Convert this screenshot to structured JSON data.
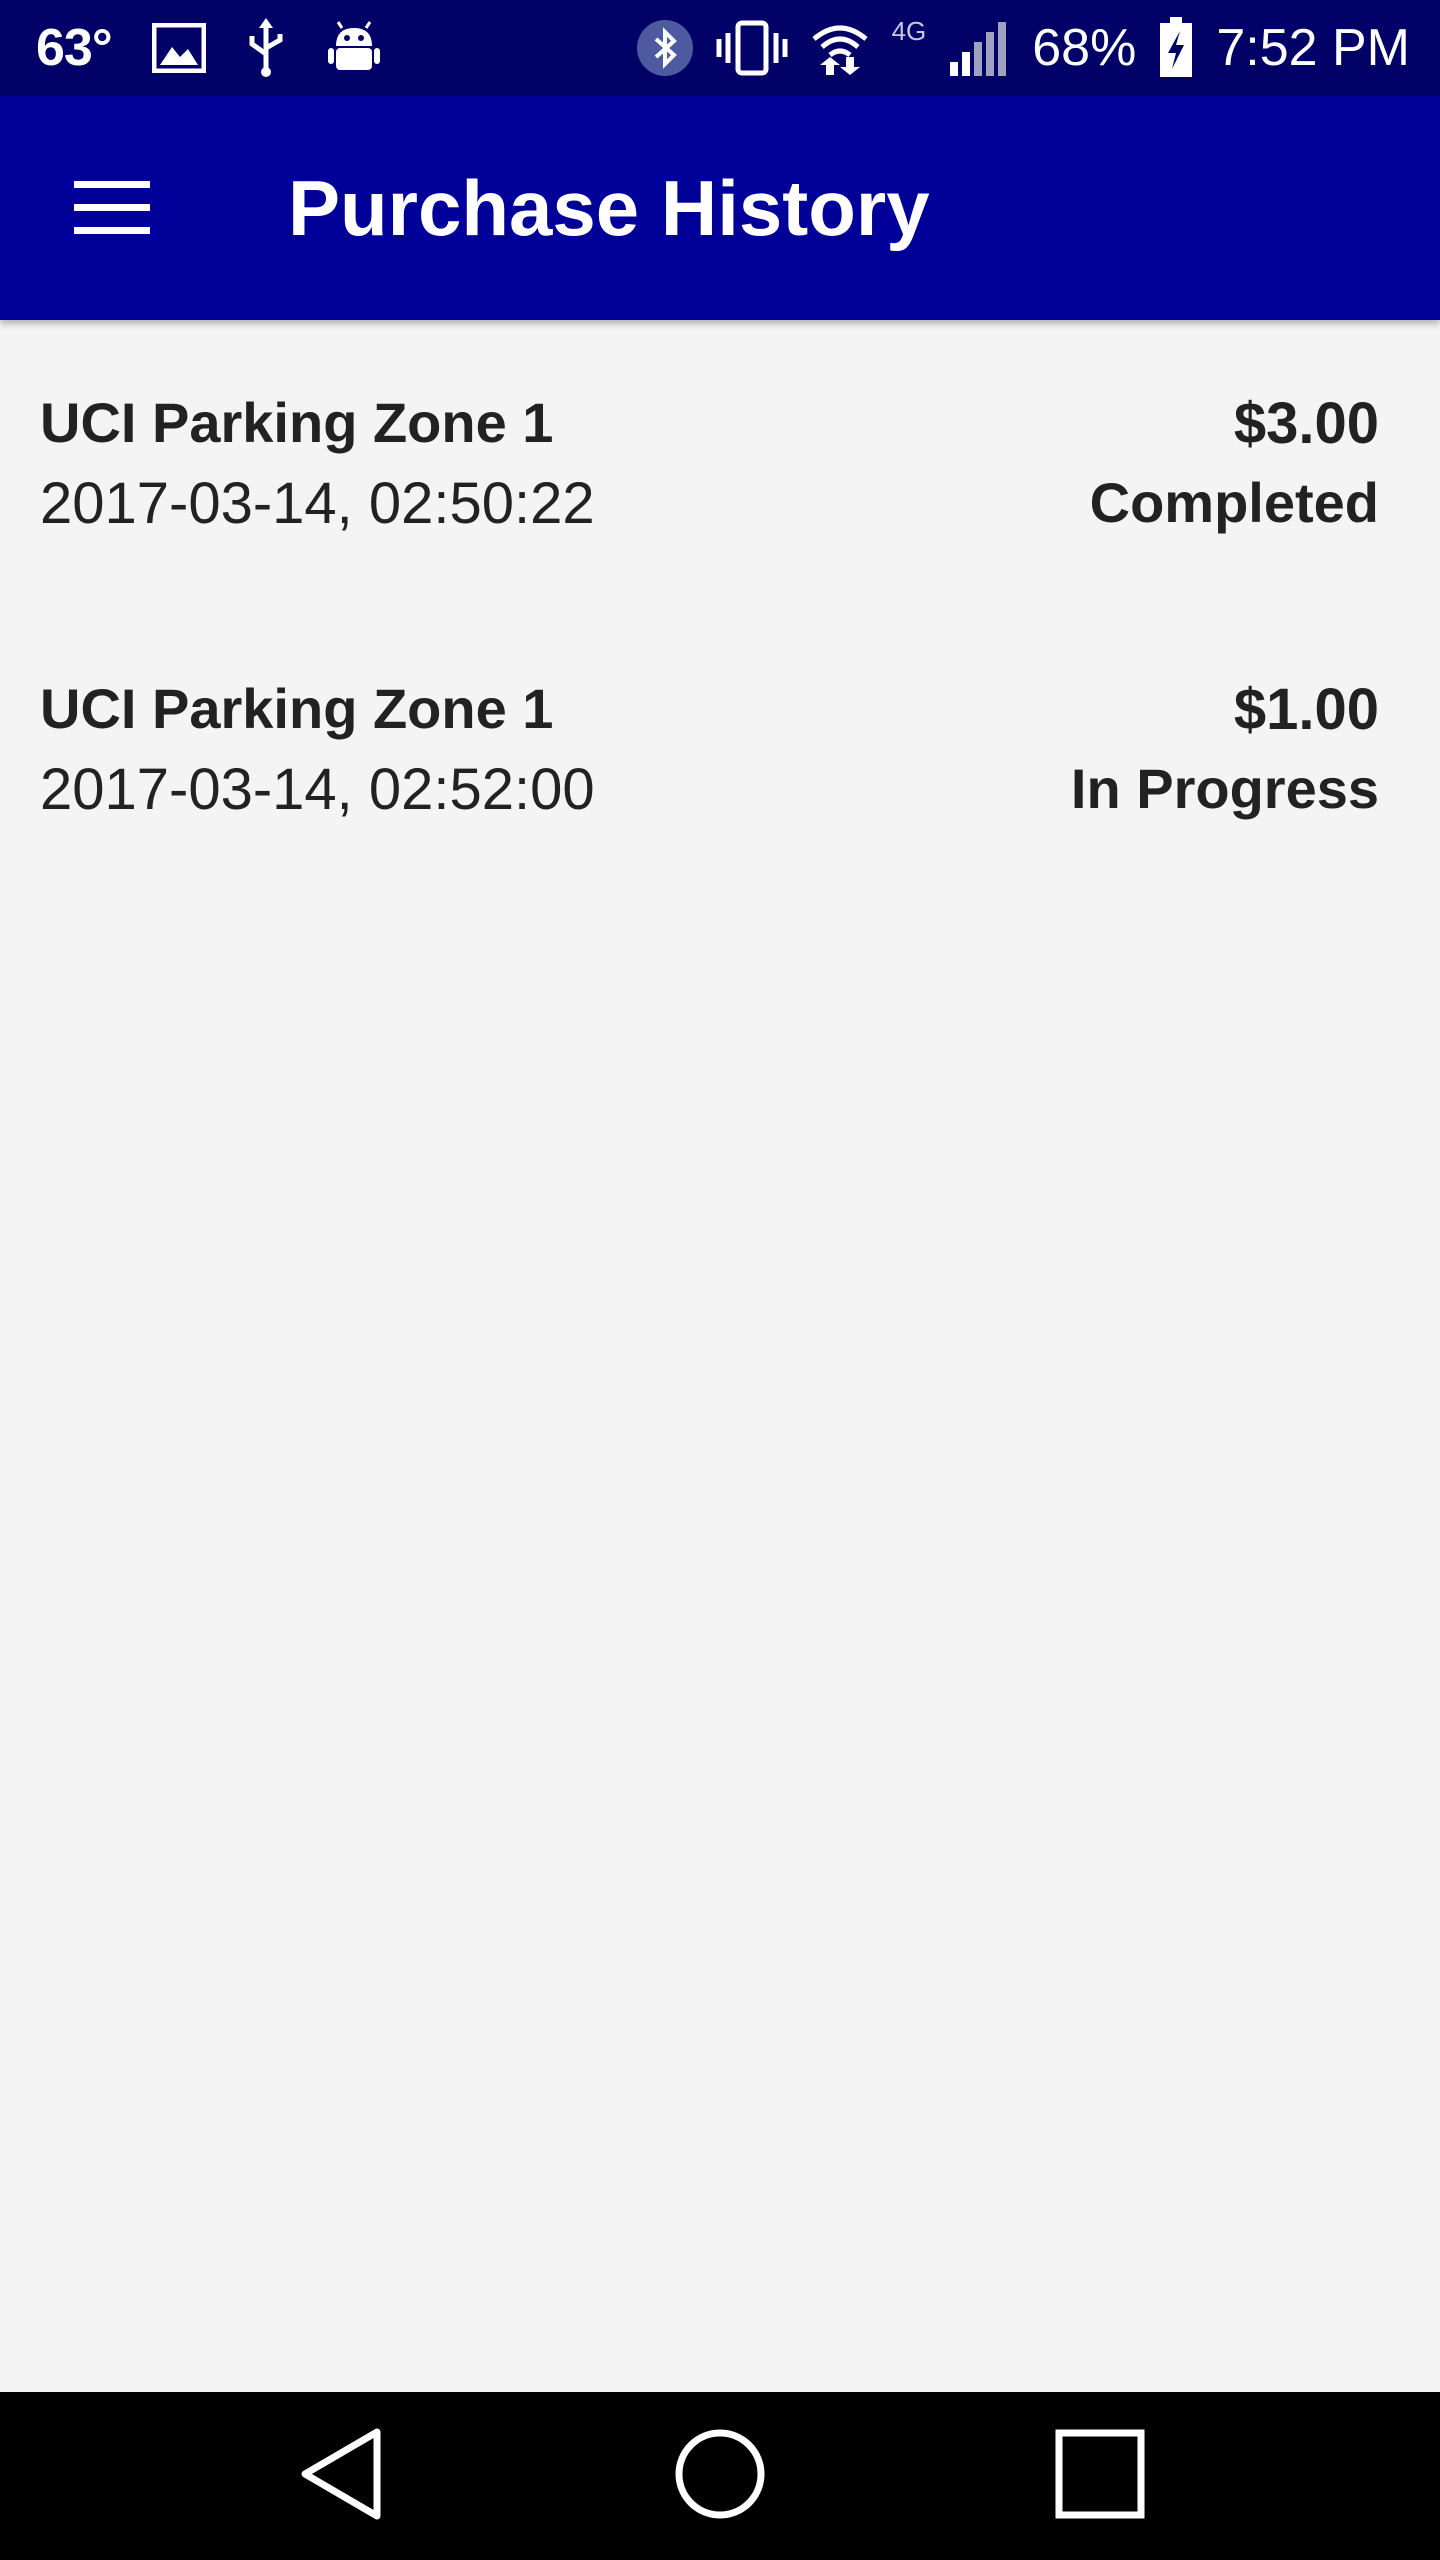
{
  "status_bar": {
    "temperature": "63°",
    "battery_percent": "68%",
    "time": "7:52 PM",
    "network_type": "4G",
    "icons": [
      "image-icon",
      "usb-icon",
      "android-debug-icon",
      "bluetooth-icon",
      "vibrate-icon",
      "wifi-icon",
      "signal-icon",
      "battery-charging-icon"
    ]
  },
  "app_bar": {
    "title": "Purchase History",
    "menu_icon": "hamburger-menu-icon",
    "background": "#000099"
  },
  "purchases": [
    {
      "location": "UCI Parking Zone 1",
      "datetime": "2017-03-14, 02:50:22",
      "amount": "$3.00",
      "status": "Completed"
    },
    {
      "location": "UCI Parking Zone 1",
      "datetime": "2017-03-14, 02:52:00",
      "amount": "$1.00",
      "status": "In Progress"
    }
  ],
  "nav_bar": {
    "icons": [
      "back-icon",
      "home-icon",
      "recents-icon"
    ]
  }
}
